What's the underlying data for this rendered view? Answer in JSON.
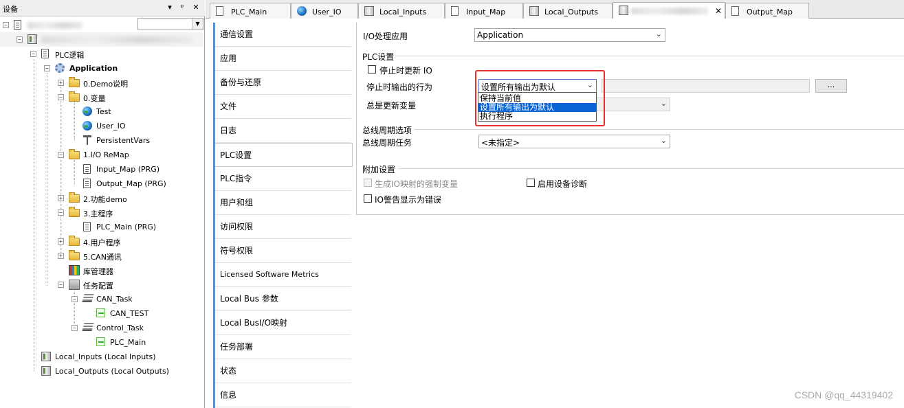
{
  "device_panel": {
    "title": "设备",
    "header_buttons": [
      "▾",
      "ᵖ",
      "✕"
    ],
    "tree": [
      {
        "label": "PLC逻辑"
      },
      {
        "label": "Application"
      },
      {
        "label": "0.Demo说明"
      },
      {
        "label": "0.变量"
      },
      {
        "label": "Test"
      },
      {
        "label": "User_IO"
      },
      {
        "label": "PersistentVars"
      },
      {
        "label": "1.I/O ReMap"
      },
      {
        "label": "Input_Map (PRG)"
      },
      {
        "label": "Output_Map (PRG)"
      },
      {
        "label": "2.功能demo"
      },
      {
        "label": "3.主程序"
      },
      {
        "label": "PLC_Main (PRG)"
      },
      {
        "label": "4.用户程序"
      },
      {
        "label": "5.CAN通讯"
      },
      {
        "label": "库管理器"
      },
      {
        "label": "任务配置"
      },
      {
        "label": "CAN_Task"
      },
      {
        "label": "CAN_TEST"
      },
      {
        "label": "Control_Task"
      },
      {
        "label": "PLC_Main"
      },
      {
        "label": "Local_Inputs (Local Inputs)"
      },
      {
        "label": "Local_Outputs (Local Outputs)"
      }
    ]
  },
  "tabs": [
    {
      "label": "PLC_Main"
    },
    {
      "label": "User_IO"
    },
    {
      "label": "Local_Inputs"
    },
    {
      "label": "Input_Map"
    },
    {
      "label": "Local_Outputs"
    },
    {
      "label": ""
    },
    {
      "label": "Output_Map"
    }
  ],
  "categories": [
    "通信设置",
    "应用",
    "备份与还原",
    "文件",
    "日志",
    "PLC设置",
    "PLC指令",
    "用户和组",
    "访问权限",
    "符号权限",
    "Licensed Software Metrics",
    "Local Bus 参数",
    "Local BusI/O映射",
    "任务部署",
    "状态",
    "信息"
  ],
  "settings": {
    "io_app_label": "I/O处理应用",
    "io_app_value": "Application",
    "plc_group": "PLC设置",
    "update_io_on_stop": "停止时更新 IO",
    "stop_behavior_label": "停止时输出的行为",
    "stop_behavior_value": "设置所有输出为默认",
    "always_update_label": "总是更新变量",
    "dots_button": "...",
    "bus_cycle_group": "总线周期选项",
    "bus_cycle_task_label": "总线周期任务",
    "bus_cycle_task_value": "<未指定>",
    "extra_group": "附加设置",
    "force_vars_label": "生成IO映射的强制变量",
    "enable_diag_label": "启用设备诊断",
    "io_warn_label": "IO警告显示为错误"
  },
  "dropdown_options": [
    "保持当前值",
    "设置所有输出为默认",
    "执行程序"
  ],
  "dropdown_selected": 1,
  "watermark": "CSDN @qq_44319402",
  "colors": {
    "accent": "#5c8fcf",
    "highlight": "#e8302a",
    "selection": "#0a64d6"
  },
  "icons": {
    "close": "close-icon",
    "pin": "pin-icon",
    "folder": "folder-icon",
    "globe": "globe-icon",
    "doc": "document-icon"
  }
}
